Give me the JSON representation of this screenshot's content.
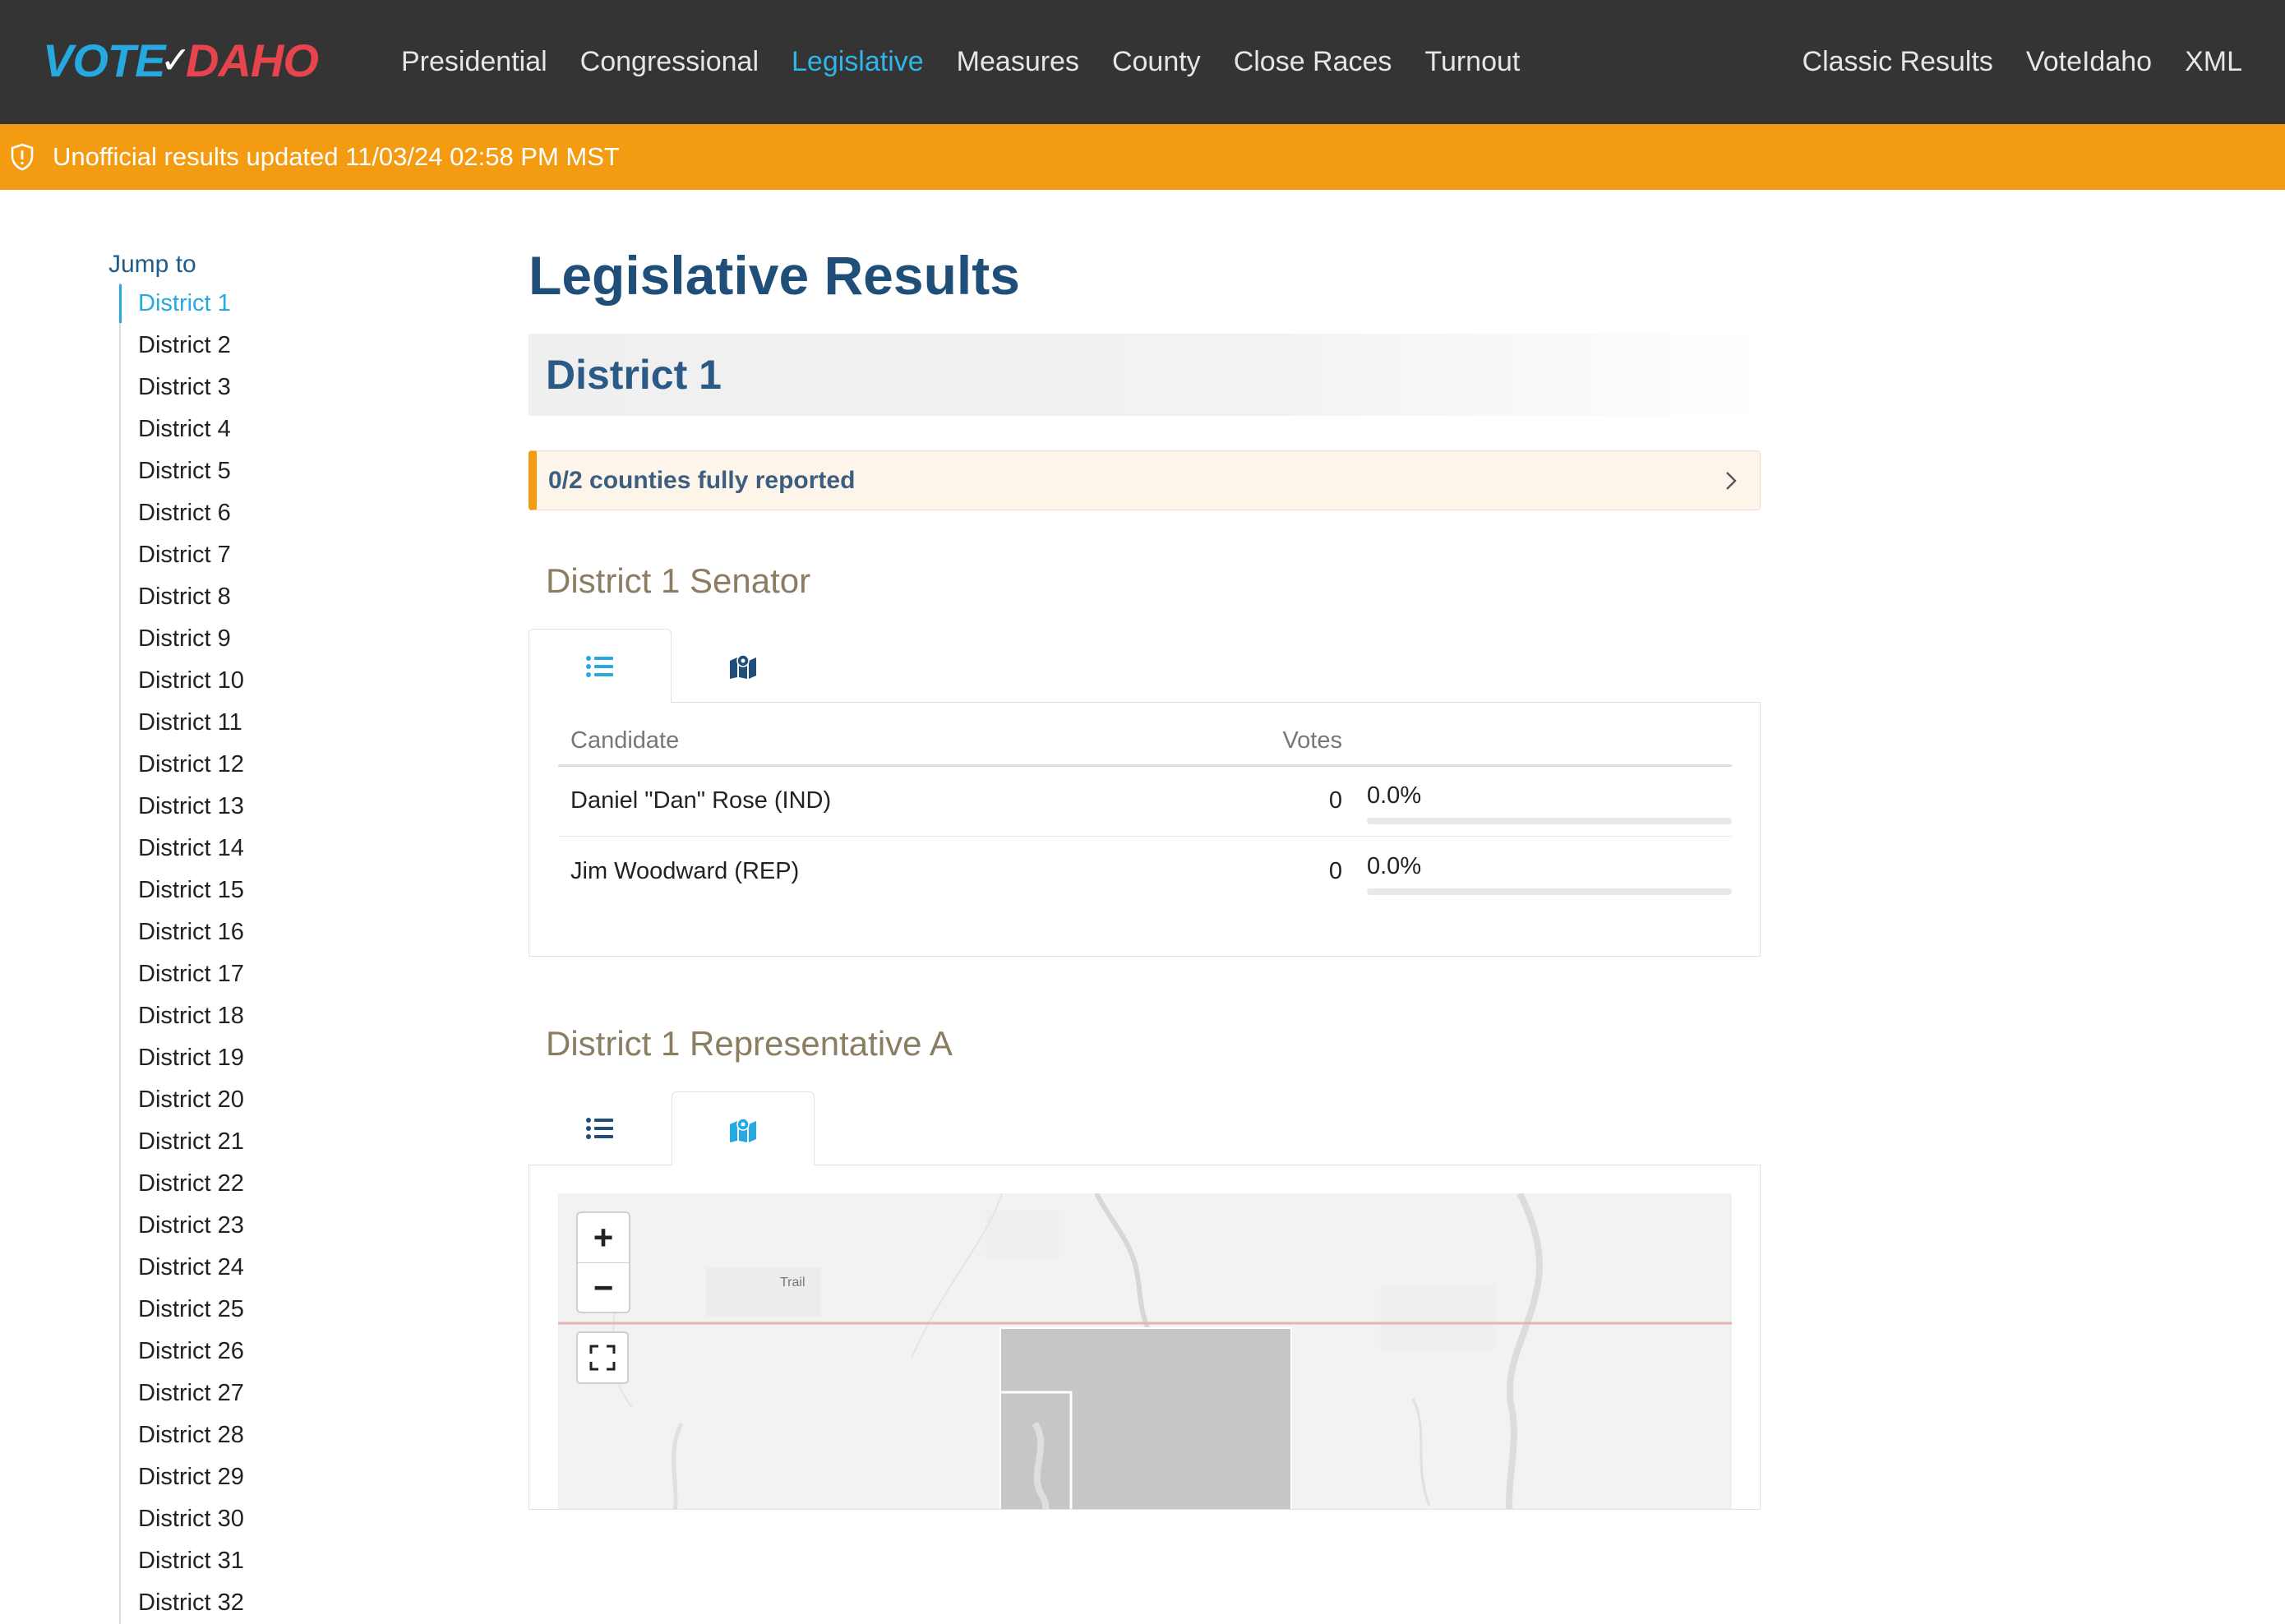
{
  "brand": {
    "vote": "VOTE",
    "idaho": "DAHO",
    "brand_colors": {
      "vote": "#25a9e0",
      "idaho": "#e8444d"
    }
  },
  "nav": {
    "left": [
      "Presidential",
      "Congressional",
      "Legislative",
      "Measures",
      "County",
      "Close Races",
      "Turnout"
    ],
    "active": "Legislative",
    "right": [
      "Classic Results",
      "VoteIdaho",
      "XML"
    ]
  },
  "alert": {
    "text": "Unofficial results updated 11/03/24 02:58 PM MST",
    "icon": "shield-exclamation-icon",
    "color": "#f39c12"
  },
  "sidebar": {
    "jump_label": "Jump to",
    "active": "District 1",
    "items": [
      "District 1",
      "District 2",
      "District 3",
      "District 4",
      "District 5",
      "District 6",
      "District 7",
      "District 8",
      "District 9",
      "District 10",
      "District 11",
      "District 12",
      "District 13",
      "District 14",
      "District 15",
      "District 16",
      "District 17",
      "District 18",
      "District 19",
      "District 20",
      "District 21",
      "District 22",
      "District 23",
      "District 24",
      "District 25",
      "District 26",
      "District 27",
      "District 28",
      "District 29",
      "District 30",
      "District 31",
      "District 32"
    ]
  },
  "main": {
    "page_title": "Legislative Results",
    "district_title": "District 1",
    "reported_text": "0/2 counties fully reported",
    "races": [
      {
        "title": "District 1 Senator",
        "active_tab": "list",
        "columns": {
          "candidate": "Candidate",
          "votes": "Votes"
        },
        "rows": [
          {
            "candidate": "Daniel \"Dan\" Rose (IND)",
            "votes": "0",
            "pct": "0.0%",
            "pct_value": 0
          },
          {
            "candidate": "Jim Woodward (REP)",
            "votes": "0",
            "pct": "0.0%",
            "pct_value": 0
          }
        ]
      },
      {
        "title": "District 1 Representative A",
        "active_tab": "map",
        "map": {
          "place_label": "Trail",
          "zoom_in": "+",
          "zoom_out": "−"
        }
      }
    ]
  },
  "icons": {
    "list_tab": "list-icon",
    "map_tab": "map-icon",
    "chevron": "chevron-right-icon",
    "fullscreen": "fullscreen-icon"
  }
}
